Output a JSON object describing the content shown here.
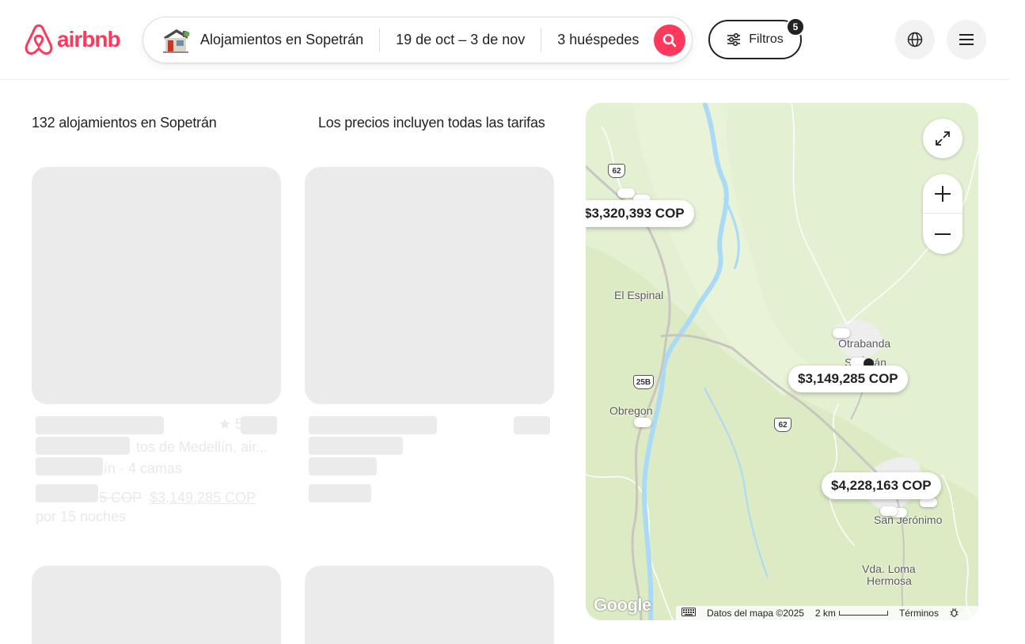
{
  "brand": {
    "name": "airbnb",
    "color": "#ff385c"
  },
  "search": {
    "location": "Alojamientos en Sopetrán",
    "dates": "19 de oct – 3 de nov",
    "guests": "3 huéspedes"
  },
  "filters": {
    "label": "Filtros",
    "count": "5"
  },
  "results": {
    "count_label": "132 alojamientos en Sopetrán",
    "prices_label": "Los precios incluyen todas las tarifas"
  },
  "listing_ghost": {
    "rating_star": "★ 5",
    "title_fragment": "tos de Medellín, air...",
    "beds_fragment": "ín · 4 camas",
    "old_price_fragment": "5 COP",
    "price": "$3,149,285 COP",
    "nights": "por 15 noches"
  },
  "map": {
    "labels": {
      "el_espinal": "El Espinal",
      "otrabanda": "Otrabanda",
      "sopetran": "S      rán",
      "obregon": "Obregon",
      "san_jeronimo": "San Jerónimo",
      "loma_hermosa_1": "Vda. Loma",
      "loma_hermosa_2": "Hermosa"
    },
    "roads": {
      "r62": "62",
      "r25b": "25B"
    },
    "pins": {
      "pin_a": "$3,320,393 COP",
      "pin_b": "$3,149,285 COP",
      "pin_c": "$4,228,163 COP"
    },
    "footer": {
      "google": "Google",
      "map_data": "Datos del mapa ©2025",
      "scale": "2 km",
      "terms": "Términos"
    }
  }
}
